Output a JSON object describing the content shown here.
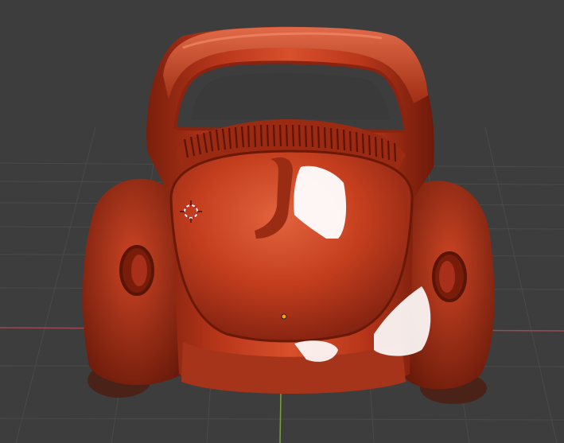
{
  "viewport": {
    "background": "#3d3d3d",
    "grid_color": "#4a4a4a",
    "x_axis_color": "#9a4a50",
    "y_axis_color": "#7aa040"
  },
  "model": {
    "body_color": "#c23a1c",
    "highlight_color": "#ffffff",
    "shadow_color": "#5a1408"
  },
  "overlays": {
    "cursor_3d_color": "#ffffff",
    "cursor_3d_ring_color": "#c0202a",
    "origin_color": "#ff9d1a"
  }
}
